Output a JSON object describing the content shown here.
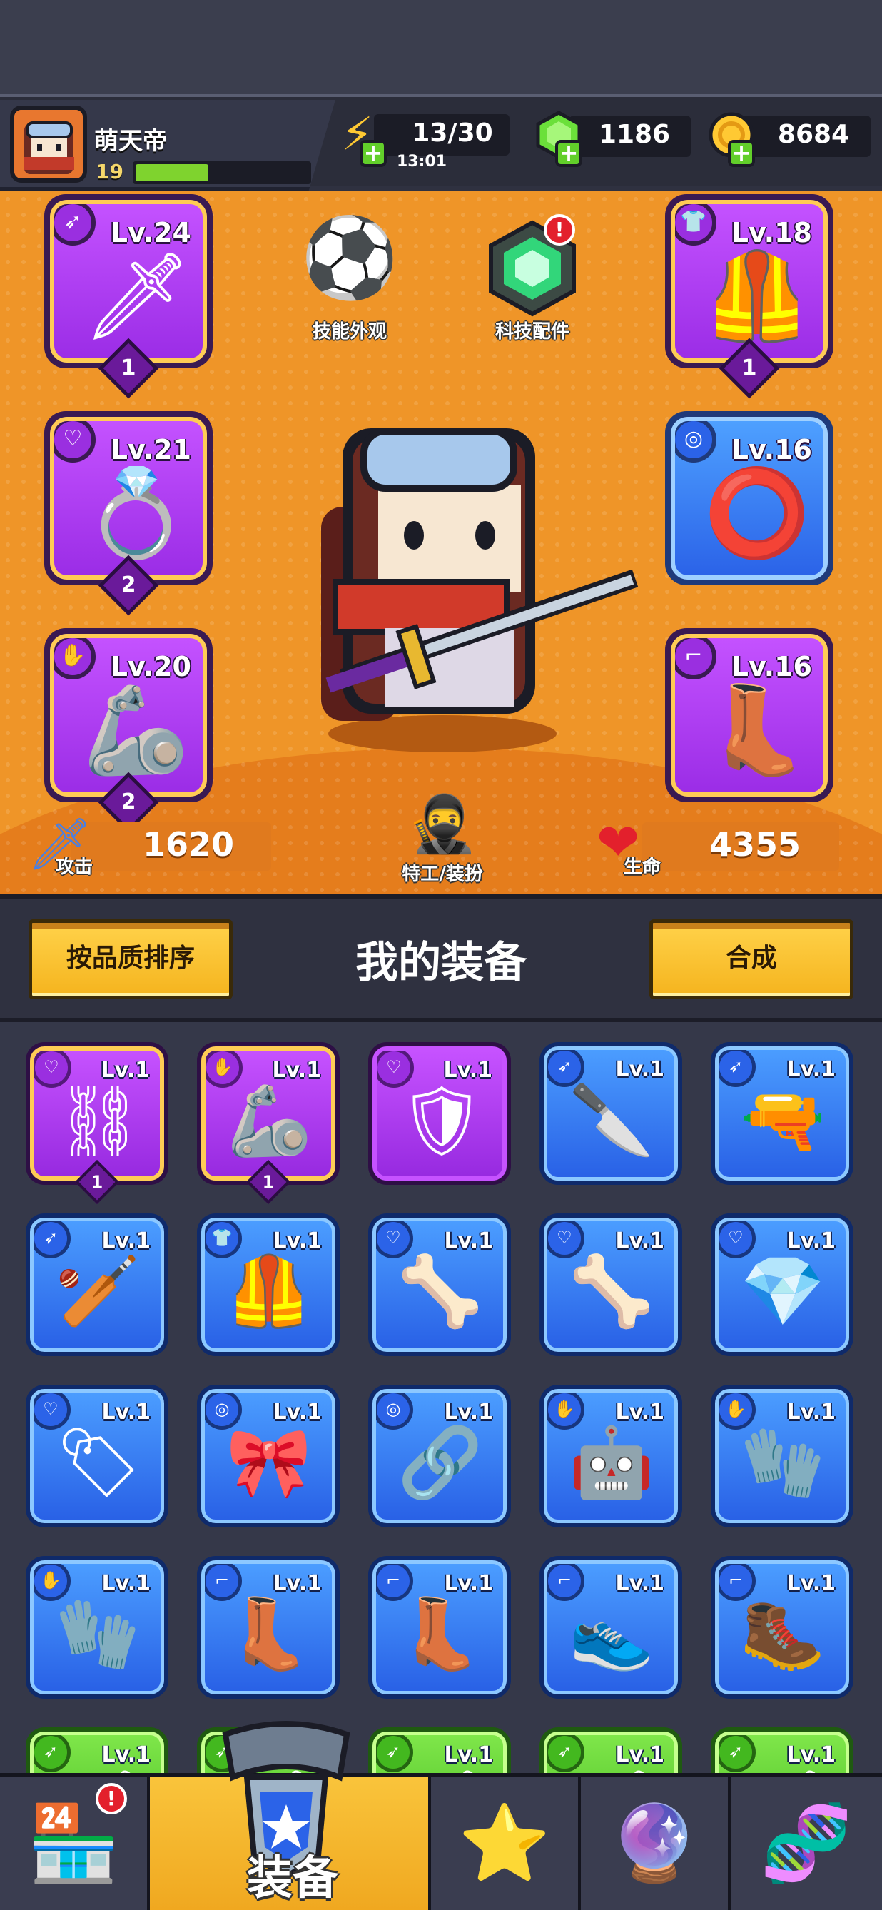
{
  "player": {
    "name": "萌天帝",
    "level": "19",
    "xp_fraction": 0.42
  },
  "resources": {
    "energy": {
      "value": "13/30",
      "timer": "13:01",
      "icon": "lightning-icon"
    },
    "gems": {
      "value": "1186",
      "icon": "green-gem-icon"
    },
    "coins": {
      "value": "8684",
      "icon": "gold-coin-icon"
    }
  },
  "hero": {
    "skin_label": "技能外观",
    "tech_label": "科技配件",
    "agent_label": "特工/装扮",
    "attack_label": "攻击",
    "attack_value": "1620",
    "hp_label": "生命",
    "hp_value": "4355"
  },
  "equipped": [
    {
      "slot": "weapon",
      "level": "Lv.24",
      "stars": "1",
      "rarity": "purple",
      "icon": "machete-icon"
    },
    {
      "slot": "armor",
      "level": "Lv.18",
      "stars": "1",
      "rarity": "purple",
      "icon": "armor-vest-icon"
    },
    {
      "slot": "necklace",
      "level": "Lv.21",
      "stars": "2",
      "rarity": "purple",
      "icon": "gem-ring-icon"
    },
    {
      "slot": "belt",
      "level": "Lv.16",
      "stars": "",
      "rarity": "blue",
      "icon": "belt-icon"
    },
    {
      "slot": "gloves",
      "level": "Lv.20",
      "stars": "2",
      "rarity": "purple",
      "icon": "power-glove-icon"
    },
    {
      "slot": "boots",
      "level": "Lv.16",
      "stars": "",
      "rarity": "purple",
      "icon": "boot-icon"
    }
  ],
  "toolbar": {
    "sort_label": "按品质排序",
    "title": "我的装备",
    "merge_label": "合成"
  },
  "inventory": [
    {
      "level": "Lv.1",
      "rarity": "purple",
      "stars": "1",
      "icon": "spiked-collar-icon"
    },
    {
      "level": "Lv.1",
      "rarity": "purple",
      "stars": "1",
      "icon": "mech-glove-icon"
    },
    {
      "level": "Lv.1",
      "rarity": "purple",
      "stars": "",
      "icon": "shield-pendant-icon"
    },
    {
      "level": "Lv.1",
      "rarity": "blue",
      "stars": "",
      "icon": "kunai-icon"
    },
    {
      "level": "Lv.1",
      "rarity": "blue",
      "stars": "",
      "icon": "revolver-icon"
    },
    {
      "level": "Lv.1",
      "rarity": "blue",
      "stars": "",
      "icon": "baseball-bat-icon"
    },
    {
      "level": "Lv.1",
      "rarity": "blue",
      "stars": "",
      "icon": "chest-armor-icon"
    },
    {
      "level": "Lv.1",
      "rarity": "blue",
      "stars": "",
      "icon": "bone-necklace-icon"
    },
    {
      "level": "Lv.1",
      "rarity": "blue",
      "stars": "",
      "icon": "bone-necklace-icon"
    },
    {
      "level": "Lv.1",
      "rarity": "blue",
      "stars": "",
      "icon": "emerald-necklace-icon"
    },
    {
      "level": "Lv.1",
      "rarity": "blue",
      "stars": "",
      "icon": "dog-tag-icon"
    },
    {
      "level": "Lv.1",
      "rarity": "blue",
      "stars": "",
      "icon": "leather-belt-icon"
    },
    {
      "level": "Lv.1",
      "rarity": "blue",
      "stars": "",
      "icon": "buckle-belt-icon"
    },
    {
      "level": "Lv.1",
      "rarity": "blue",
      "stars": "",
      "icon": "robot-glove-icon"
    },
    {
      "level": "Lv.1",
      "rarity": "blue",
      "stars": "",
      "icon": "camo-glove-icon"
    },
    {
      "level": "Lv.1",
      "rarity": "blue",
      "stars": "",
      "icon": "camo-glove-icon"
    },
    {
      "level": "Lv.1",
      "rarity": "blue",
      "stars": "",
      "icon": "brown-boot-icon"
    },
    {
      "level": "Lv.1",
      "rarity": "blue",
      "stars": "",
      "icon": "brown-boot-icon"
    },
    {
      "level": "Lv.1",
      "rarity": "blue",
      "stars": "",
      "icon": "sneaker-icon"
    },
    {
      "level": "Lv.1",
      "rarity": "blue",
      "stars": "",
      "icon": "combat-boot-icon"
    },
    {
      "level": "Lv.1",
      "rarity": "green",
      "stars": "",
      "icon": "weapon-icon"
    },
    {
      "level": "",
      "rarity": "green",
      "stars": "",
      "icon": "weapon-icon"
    },
    {
      "level": "Lv.1",
      "rarity": "green",
      "stars": "",
      "icon": "weapon-icon"
    },
    {
      "level": "Lv.1",
      "rarity": "green",
      "stars": "",
      "icon": "weapon-icon"
    },
    {
      "level": "Lv.1",
      "rarity": "green",
      "stars": "",
      "icon": "weapon-icon"
    }
  ],
  "nav": {
    "shop_icon": "shop-icon",
    "shop_notification": "!",
    "tech_notification": "!",
    "equip_label": "装备",
    "equip_icon": "necklace-star-icon",
    "heroes_icon": "crossed-swords-star-icon",
    "talent_icon": "star-orb-icon",
    "evolve_icon": "dna-capsule-icon"
  },
  "colors": {
    "hero_bg": "#ef9528",
    "purple_rarity": "#b43ff0",
    "blue_rarity": "#3a7cf5",
    "green_rarity": "#62cf2a",
    "accent_yellow": "#f5b41e"
  }
}
